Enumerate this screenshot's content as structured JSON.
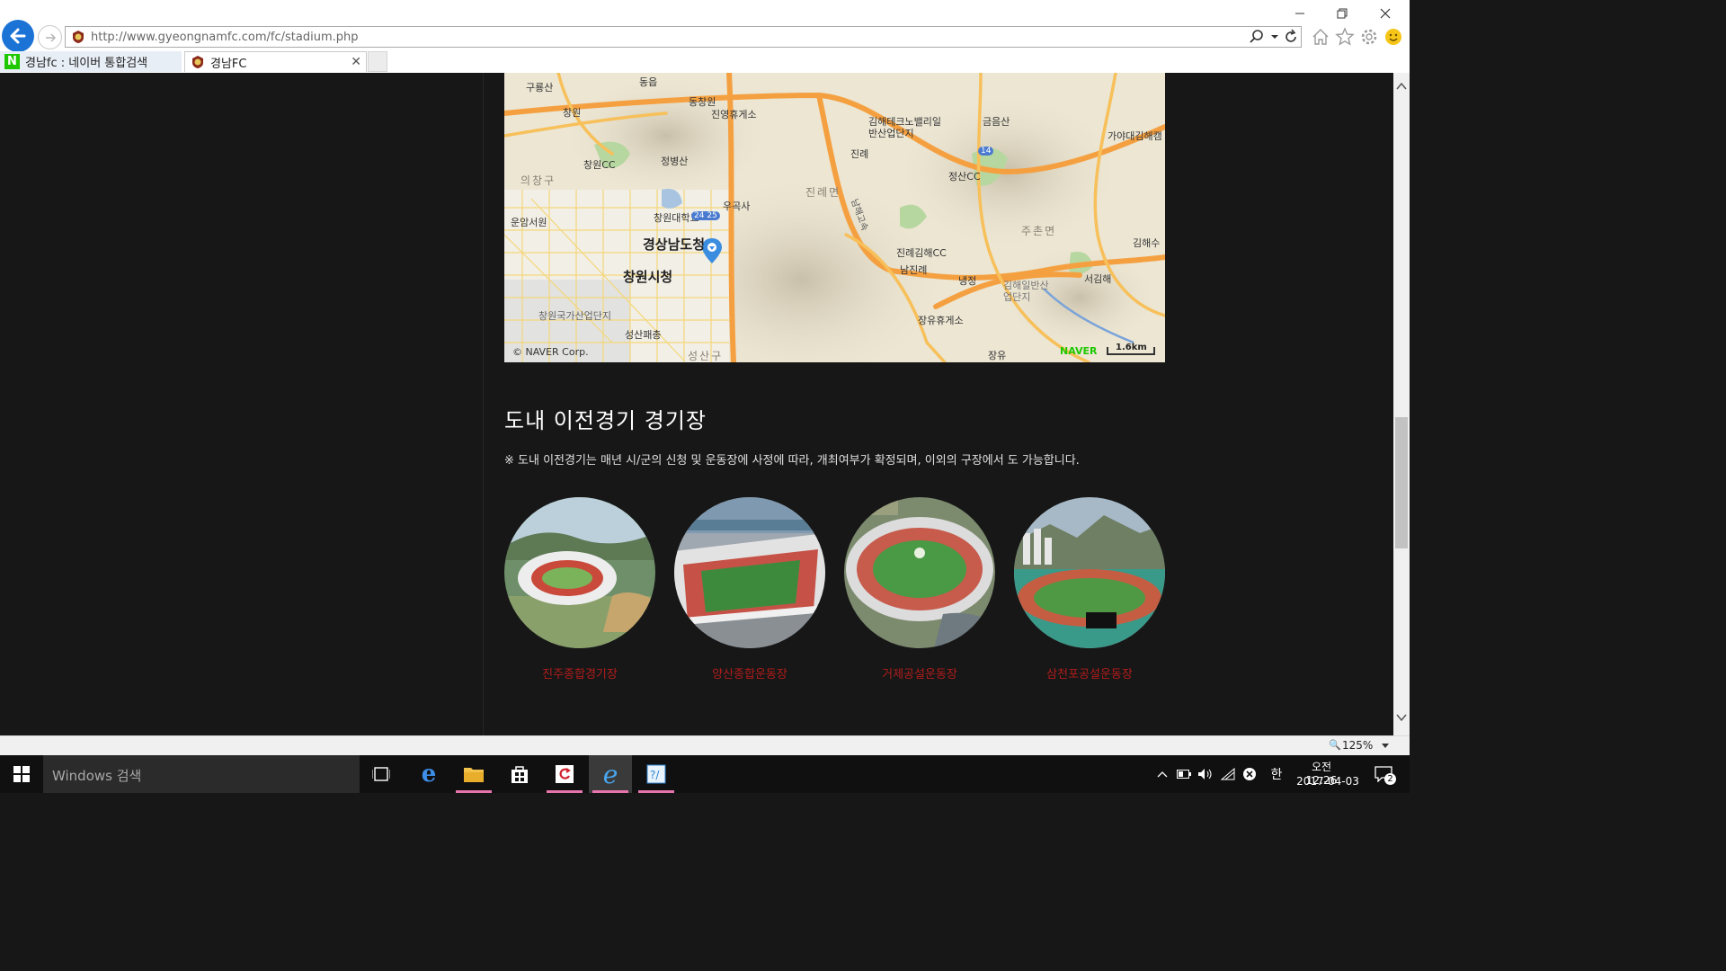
{
  "browser": {
    "url": "http://www.gyeongnamfc.com/fc/stadium.php",
    "tabs": [
      {
        "label": "경남fc : 네이버 통합검색"
      },
      {
        "label": "경남FC"
      }
    ],
    "zoom": "125%"
  },
  "map": {
    "copyright": "© NAVER Corp.",
    "brand": "NAVER",
    "scale": "1.6km",
    "labels": {
      "l1": "구룡산",
      "l2": "동읍",
      "l3": "동창원",
      "l4": "진영휴게소",
      "l5": "창원",
      "l6": "창원CC",
      "l7": "정병산",
      "l8": "의창구",
      "l9": "운암서원",
      "l10": "창원대학교",
      "l11": "우곡사",
      "l12": "경상남도청",
      "l13": "창원시청",
      "l14": "창원국가산업단지",
      "l15": "성산패총",
      "l16": "성산구",
      "l17": "김해테크노밸리일반산업단지",
      "l18": "진례",
      "l19": "진례면",
      "l20": "금음산",
      "l21": "정산CC",
      "l22": "가야대김해캠",
      "l23": "진례김해CC",
      "l24": "남진례",
      "l25": "냉정",
      "l26": "장유휴게소",
      "l27": "김해일반산업단지",
      "l28": "주촌면",
      "l29": "김해수",
      "l30": "서김해",
      "l31": "장유",
      "l32": "24 25",
      "l33": "14",
      "l34": "남해고속"
    }
  },
  "section": {
    "title": "도내 이전경기 경기장",
    "note": "※ 도내 이전경기는 매년 시/군의 신청 및 운동장에 사정에 따라, 개최여부가 확정되며, 이외의 구장에서 도 가능합니다."
  },
  "stadiums": [
    {
      "name": "진주종합경기장"
    },
    {
      "name": "양산종합운동장"
    },
    {
      "name": "거제공설운동장"
    },
    {
      "name": "삼천포공설운동장"
    }
  ],
  "taskbar": {
    "search_placeholder": "Windows 검색",
    "time": "오전 12:26",
    "date": "2017-04-03",
    "ime": "한",
    "notif_count": "2"
  },
  "colors": {
    "page_bg": "#171717",
    "stadium_name": "#b21c1c",
    "naver_green": "#1ec800",
    "ie_blue": "#1b73d6"
  }
}
